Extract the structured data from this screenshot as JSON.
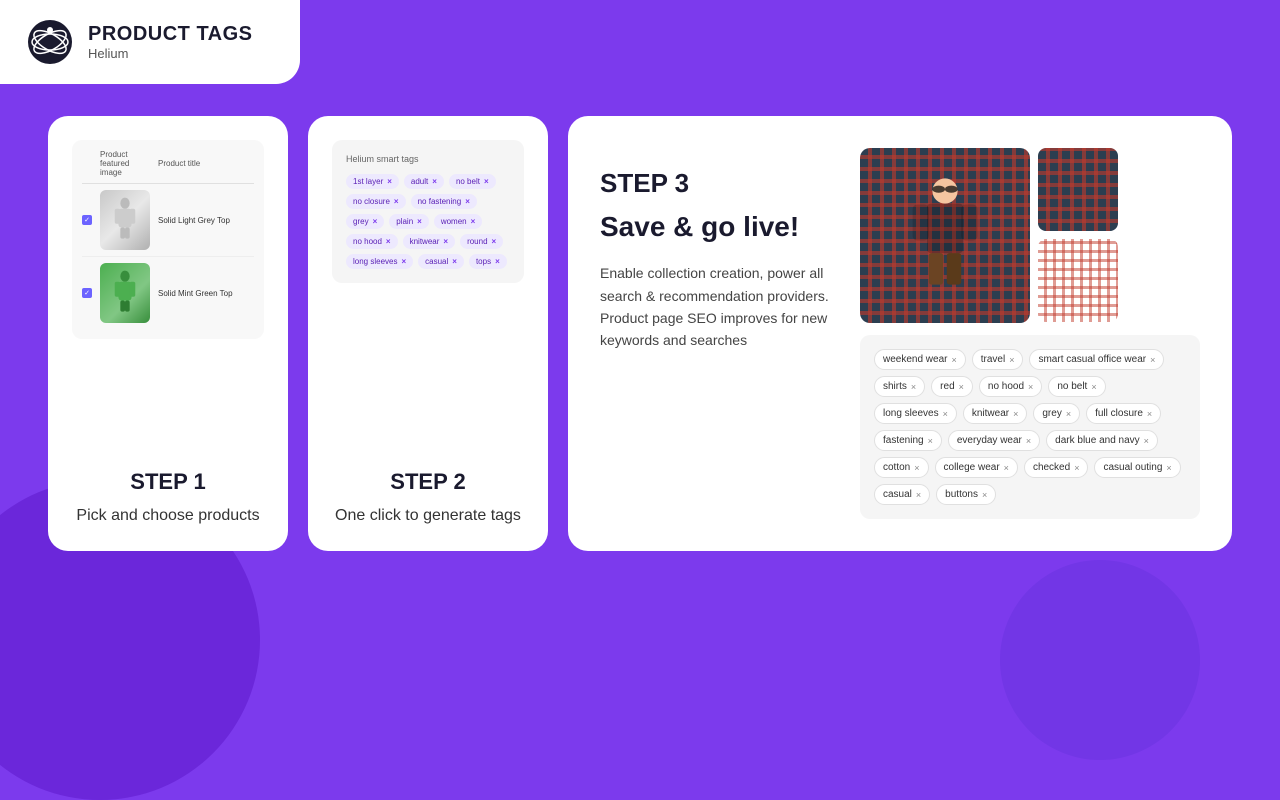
{
  "header": {
    "brand": "Helium",
    "title": "PRODUCT TAGS"
  },
  "step1": {
    "label": "STEP 1",
    "description": "Pick and choose products",
    "table": {
      "headers": [
        "Product featured image",
        "Product title"
      ],
      "rows": [
        {
          "name": "Solid Light Grey Top",
          "checked": true
        },
        {
          "name": "Solid Mint Green Top",
          "checked": true
        }
      ]
    }
  },
  "step2": {
    "label": "STEP 2",
    "description": "One click to generate tags",
    "smart_tags_title": "Helium smart tags",
    "tags": [
      "1st layer",
      "adult",
      "no belt",
      "no closure",
      "no fastening",
      "grey",
      "plain",
      "women",
      "no hood",
      "knitwear",
      "round",
      "long sleeves",
      "casual",
      "tops"
    ]
  },
  "step3": {
    "label": "STEP 3",
    "headline": "Save & go live!",
    "description": "Enable collection creation, power all search & recommendation providers. Product page SEO improves for new keywords and searches",
    "result_tags": [
      "weekend wear",
      "travel",
      "smart casual office wear",
      "shirts",
      "red",
      "no hood",
      "no belt",
      "long sleeves",
      "knitwear",
      "grey",
      "full closure",
      "fastening",
      "everyday wear",
      "dark blue and navy",
      "cotton",
      "college wear",
      "checked",
      "casual outing",
      "casual",
      "buttons"
    ]
  }
}
